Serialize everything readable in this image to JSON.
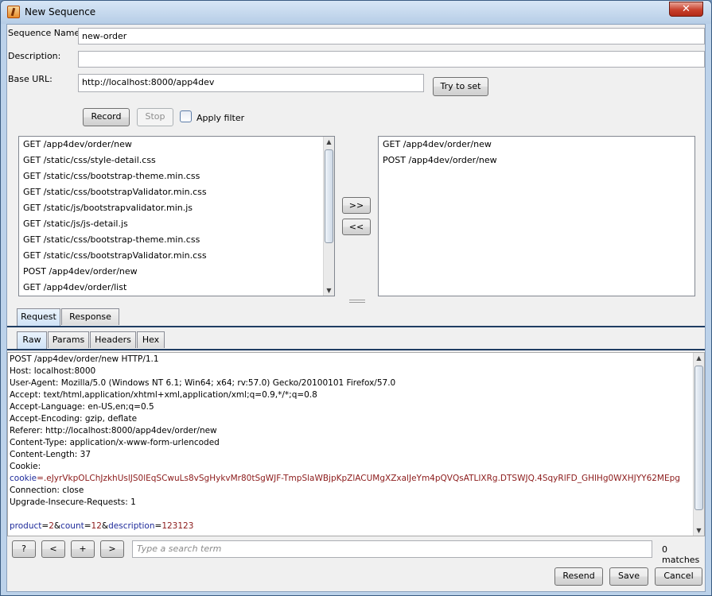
{
  "window": {
    "title": "New Sequence",
    "close_label": "✕"
  },
  "form": {
    "sequence_name_label": "Sequence Name:",
    "sequence_name_value": "new-order",
    "description_label": "Description:",
    "description_value": "",
    "base_url_label": "Base URL:",
    "base_url_value": "http://localhost:8000/app4dev",
    "try_to_set_label": "Try to set"
  },
  "recorder": {
    "record_label": "Record",
    "stop_label": "Stop",
    "apply_filter_label": "Apply filter"
  },
  "left_list": {
    "items": [
      "GET  /app4dev/order/new",
      "GET  /static/css/style-detail.css",
      "GET  /static/css/bootstrap-theme.min.css",
      "GET  /static/css/bootstrapValidator.min.css",
      "GET  /static/js/bootstrapvalidator.min.js",
      "GET  /static/js/js-detail.js",
      "GET  /static/css/bootstrap-theme.min.css",
      "GET  /static/css/bootstrapValidator.min.css",
      "POST  /app4dev/order/new",
      "GET  /app4dev/order/list"
    ]
  },
  "right_list": {
    "items": [
      "GET  /app4dev/order/new",
      "POST  /app4dev/order/new"
    ]
  },
  "transfer": {
    "add_label": ">>",
    "remove_label": "<<"
  },
  "outer_tabs": {
    "request_label": "Request",
    "response_label": "Response"
  },
  "inner_tabs": {
    "raw_label": "Raw",
    "params_label": "Params",
    "headers_label": "Headers",
    "hex_label": "Hex"
  },
  "request": {
    "lines": [
      "POST /app4dev/order/new HTTP/1.1",
      "Host: localhost:8000",
      "User-Agent: Mozilla/5.0 (Windows NT 6.1; Win64; x64; rv:57.0) Gecko/20100101 Firefox/57.0",
      "Accept: text/html,application/xhtml+xml,application/xml;q=0.9,*/*;q=0.8",
      "Accept-Language: en-US,en;q=0.5",
      "Accept-Encoding: gzip, deflate",
      "Referer: http://localhost:8000/app4dev/order/new",
      "Content-Type: application/x-www-form-urlencoded",
      "Content-Length: 37",
      "Cookie:"
    ],
    "cookie_key": "cookie",
    "cookie_value": "=.eJyrVkpOLChJzkhUslJS0lEqSCwuLs8vSgHykvMr80tSgWJF-TmpSlaWBjpKpZlACUMgXZxalJeYm4pQVQsATLIXRg.DTSWJQ.4SqyRlFD_GHlHg0WXHJYY62MEpg",
    "after_cookie": [
      "Connection: close",
      "Upgrade-Insecure-Requests: 1"
    ],
    "body": {
      "k1": "product",
      "v1": "2",
      "k2": "count",
      "v2": "12",
      "k3": "description",
      "v3": "123123"
    }
  },
  "search": {
    "help_label": "?",
    "prev_label": "<",
    "add_label": "+",
    "next_label": ">",
    "placeholder": "Type a search term",
    "matches": "0 matches"
  },
  "footer": {
    "resend_label": "Resend",
    "save_label": "Save",
    "cancel_label": "Cancel"
  }
}
